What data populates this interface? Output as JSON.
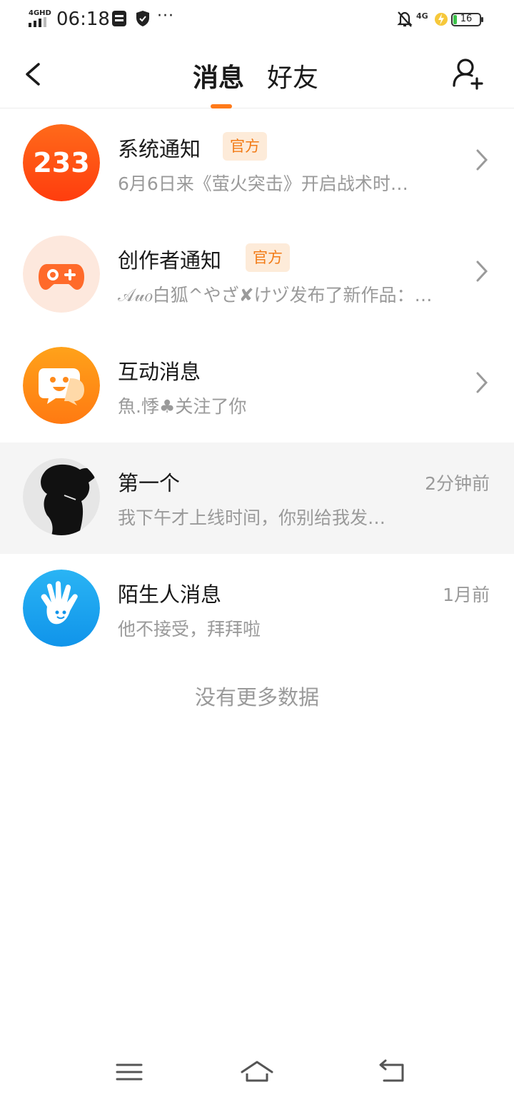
{
  "status_bar": {
    "network": "4GHD",
    "time": "06:18",
    "more": "···",
    "network_right": "4G",
    "battery": "16",
    "battery_level": 0.16,
    "icons": [
      "sim-card-icon",
      "shield-icon",
      "bell-off-icon",
      "charging-icon"
    ]
  },
  "header": {
    "tabs": [
      {
        "label": "消息",
        "active": true
      },
      {
        "label": "好友",
        "active": false
      }
    ],
    "accent_color": "#ff7a1a",
    "icons": {
      "back": "back-arrow-icon",
      "add_friend": "add-friend-icon"
    }
  },
  "messages": [
    {
      "title": "系统通知",
      "badge": "官方",
      "subtitle": "6月6日来《萤火突击》开启战术时…",
      "time": "",
      "avatar": "233-logo",
      "color": "#ff5512"
    },
    {
      "title": "创作者通知",
      "badge": "官方",
      "subtitle": "𝒜𝓊𝑜白狐^やざ✘けヅ发布了新作品：…",
      "time": "",
      "avatar": "gamepad-icon",
      "color": "#ff6a2a"
    },
    {
      "title": "互动消息",
      "badge": "",
      "subtitle": "魚.悸♣关注了你",
      "time": "",
      "avatar": "chat-bubble-icon",
      "color": "#ff8c1a"
    },
    {
      "title": "第一个",
      "badge": "",
      "subtitle": "我下午才上线时间，你别给我发…",
      "time": "2分钟前",
      "avatar": "user-silhouette",
      "color": "#333333"
    },
    {
      "title": "陌生人消息",
      "badge": "",
      "subtitle": "他不接受，拜拜啦",
      "time": "1月前",
      "avatar": "waving-hand-icon",
      "color": "#1fa8f0"
    }
  ],
  "footer": {
    "no_more": "没有更多数据"
  },
  "nav_bar": {
    "icons": [
      "menu-icon",
      "home-icon",
      "back-icon"
    ]
  }
}
